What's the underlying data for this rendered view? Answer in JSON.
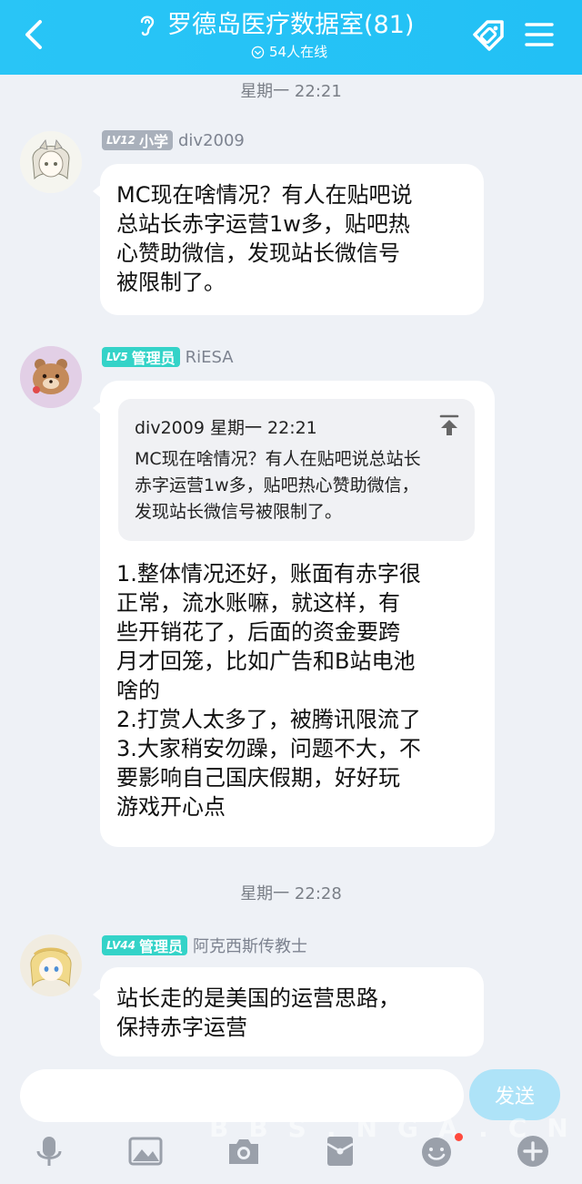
{
  "header": {
    "title": "罗德岛医疗数据室(81)",
    "online": "54人在线"
  },
  "messages": [
    {
      "time": "星期一 22:21",
      "level": "LV12",
      "role": "小学",
      "user": "div2009",
      "lines": [
        "MC现在啥情况？有人在贴吧说",
        "总站长赤字运营1w多，贴吧热",
        "心赞助微信，发现站长微信号",
        "被限制了。"
      ]
    },
    {
      "level": "LV5",
      "role": "管理员",
      "user": "RiESA",
      "quote": {
        "header": "div2009 星期一 22:21",
        "lines": [
          "MC现在啥情况？有人在贴吧说总站长",
          "赤字运营1w多，贴吧热心赞助微信，",
          "发现站长微信号被限制了。"
        ]
      },
      "lines": [
        "1.整体情况还好，账面有赤字很",
        "正常，流水账嘛，就这样，有",
        "些开销花了，后面的资金要跨",
        "月才回笼，比如广告和B站电池",
        "啥的",
        "2.打赏人太多了，被腾讯限流了",
        "3.大家稍安勿躁，问题不大，不",
        "要影响自己国庆假期，好好玩",
        "游戏开心点"
      ]
    },
    {
      "time": "星期一 22:28",
      "level": "LV44",
      "role": "管理员",
      "user": "阿克西斯传教士",
      "lines": [
        "站长走的是美国的运营思路，",
        "保持赤字运营"
      ]
    }
  ],
  "input": {
    "send_label": "发送"
  },
  "toolbar": [
    "mic-icon",
    "image-icon",
    "camera-icon",
    "red-packet-icon",
    "emoji-icon",
    "plus-icon"
  ],
  "watermark": "BBS.NGA.CN"
}
